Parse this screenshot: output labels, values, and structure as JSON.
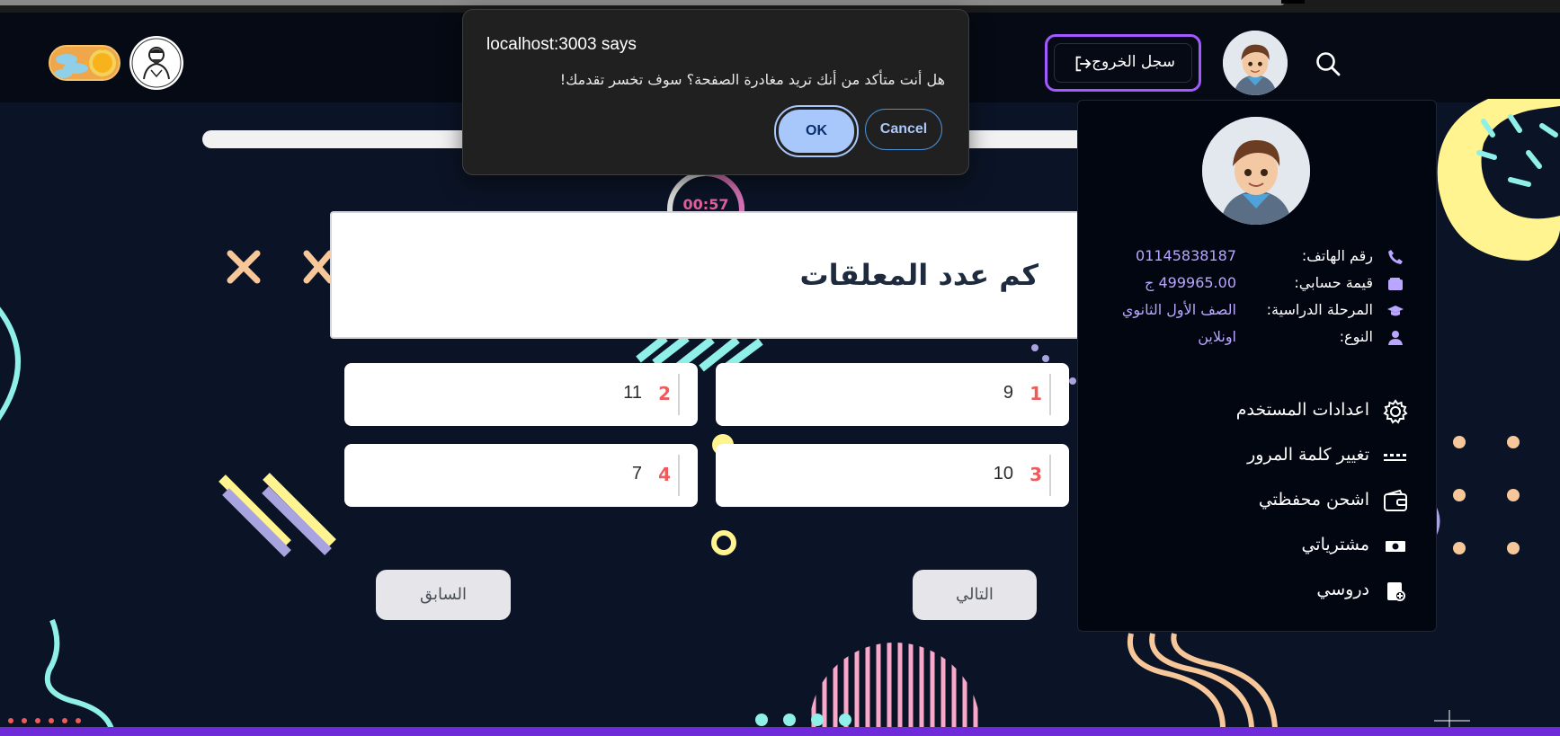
{
  "dialog": {
    "title": "localhost:3003 says",
    "message": "هل أنت متأكد من أنك تريد مغادرة الصفحة؟ سوف تخسر تقدمك!",
    "ok_label": "OK",
    "cancel_label": "Cancel"
  },
  "header": {
    "logout_label": "سجل الخروج",
    "theme_mode": "light"
  },
  "quiz": {
    "timer": "00:57",
    "timer_fraction": 0.63,
    "progress_fraction": 1.0,
    "question": "كم عدد المعلقات",
    "options": [
      {
        "number": "1",
        "value": "9"
      },
      {
        "number": "2",
        "value": "11"
      },
      {
        "number": "3",
        "value": "10"
      },
      {
        "number": "4",
        "value": "7"
      }
    ],
    "next_label": "التالي",
    "prev_label": "السابق"
  },
  "profile": {
    "phone_label": "رقم الهاتف:",
    "phone_value": "01145838187",
    "balance_label": "قيمة حسابي:",
    "balance_value": "499965.00 ج",
    "stage_label": "المرحلة الدراسية:",
    "stage_value": "الصف الأول الثانوي",
    "type_label": "النوع:",
    "type_value": "اونلاين"
  },
  "menu": [
    {
      "label": "اعدادات المستخدم",
      "icon": "gear-icon"
    },
    {
      "label": "تغيير كلمة المرور",
      "icon": "password-icon"
    },
    {
      "label": "اشحن محفظتي",
      "icon": "wallet-icon"
    },
    {
      "label": "مشترياتي",
      "icon": "money-icon"
    },
    {
      "label": "دروسي",
      "icon": "lessons-icon"
    }
  ],
  "colors": {
    "accent": "#a259ff",
    "background": "#0b1426",
    "option_number": "#ef5b5b",
    "profile_value": "#b9a6ff",
    "timer": "#e0609b"
  }
}
